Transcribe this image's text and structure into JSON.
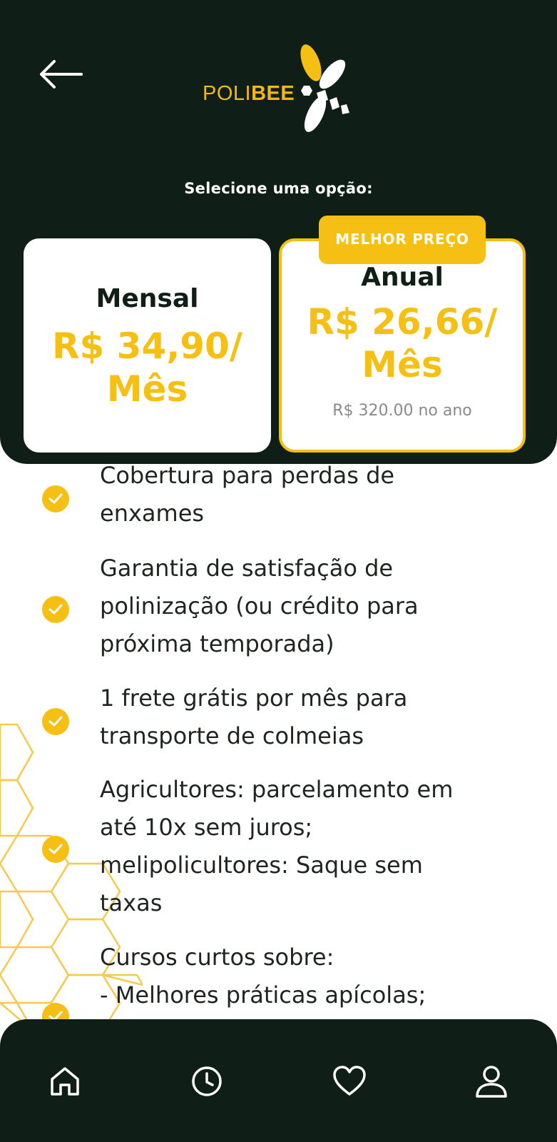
{
  "header": {
    "logo": {
      "text_light": "POLI",
      "text_bold": "BEE"
    },
    "prompt": "Selecione uma opção:"
  },
  "plans": [
    {
      "name": "Mensal",
      "price_line1": "R$ 34,90/",
      "price_line2": "Mês",
      "note": ""
    },
    {
      "name": "Anual",
      "price_line1": "R$ 26,66/",
      "price_line2": "Mês",
      "note": "R$ 320.00 no ano",
      "badge": "MELHOR PREÇO"
    }
  ],
  "benefits": [
    {
      "text": "Cobertura para perdas de\nenxames"
    },
    {
      "text": "Garantia de satisfação de\npolinização (ou crédito para\npróxima temporada)"
    },
    {
      "text": "1 frete grátis por mês para\ntransporte de colmeias"
    },
    {
      "text": "Agricultores: parcelamento em\naté 10x sem juros;\nmelipolicultores: Saque sem\ntaxas"
    },
    {
      "text": "Cursos curtos sobre:\n- Melhores práticas apícolas;"
    }
  ],
  "nav": {
    "items": [
      {
        "icon": "home-icon"
      },
      {
        "icon": "clock-icon"
      },
      {
        "icon": "heart-icon"
      },
      {
        "icon": "user-icon"
      }
    ]
  },
  "colors": {
    "dark": "#0f1f17",
    "accent": "#f6bf13",
    "white": "#ffffff"
  }
}
